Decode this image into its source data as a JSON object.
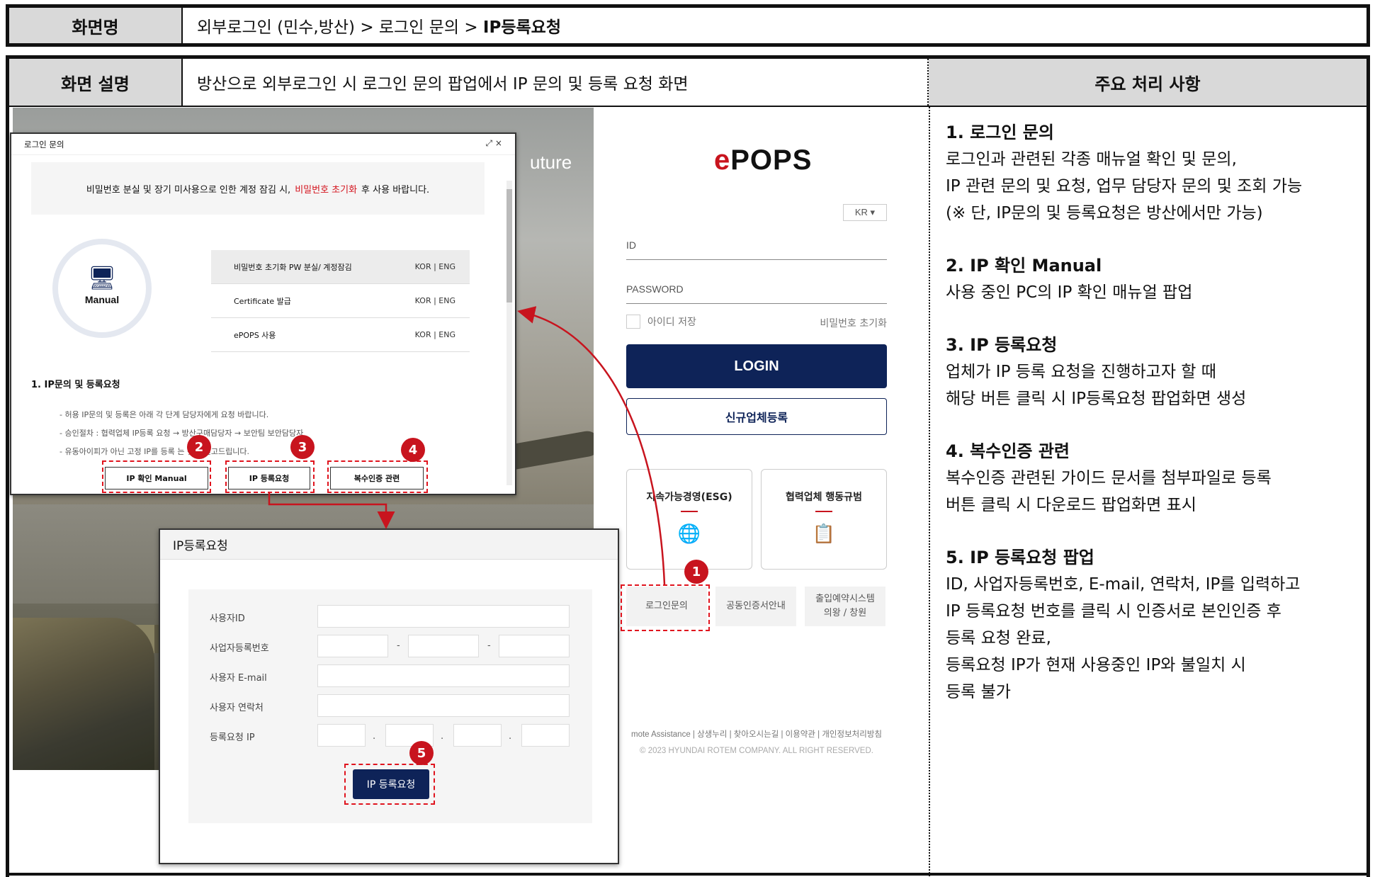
{
  "titlebar": {
    "label": "화면명",
    "path_prefix": "외부로그인 (민수,방산) > 로그인 문의 > ",
    "path_current": "IP등록요청"
  },
  "header": {
    "label": "화면 설명",
    "description": "방산으로 외부로그인 시 로그인 문의 팝업에서 IP 문의 및 등록 요청 화면",
    "side_title": "주요 처리 사항"
  },
  "notes": [
    {
      "title": "1.  로그인 문의",
      "lines": [
        "로그인과 관련된 각종 매뉴얼 확인 및 문의,",
        "IP 관련 문의 및 요청, 업무 담당자 문의 및 조회 가능",
        "(※ 단, IP문의 및 등록요청은 방산에서만 가능)"
      ]
    },
    {
      "title": "2.   IP 확인 Manual",
      "lines": [
        "사용 중인 PC의 IP 확인 매뉴얼 팝업"
      ]
    },
    {
      "title": "3.  IP 등록요청",
      "lines": [
        "업체가 IP 등록 요청을 진행하고자 할 때",
        "해당 버튼 클릭 시 IP등록요청 팝업화면 생성"
      ]
    },
    {
      "title": "4.  복수인증 관련",
      "lines": [
        "복수인증 관련된 가이드 문서를 첨부파일로 등록",
        "버튼 클릭 시 다운로드 팝업화면 표시"
      ]
    },
    {
      "title": "5.  IP 등록요청 팝업",
      "lines": [
        "ID, 사업자등록번호, E-mail, 연락처, IP를 입력하고",
        "IP 등록요청 번호를 클릭 시 인증서로 본인인증 후",
        "등록 요청 완료,",
        "등록요청 IP가 현재 사용중인 IP와 불일치 시",
        "등록 불가"
      ]
    }
  ],
  "background": {
    "slogan": "uture"
  },
  "login": {
    "logo_e": "e",
    "logo_rest": "POPS",
    "lang": "KR ▾",
    "id_label": "ID",
    "password_label": "PASSWORD",
    "save_id": "아이디 저장",
    "reset_pw": "비밀번호 초기화",
    "login_btn": "LOGIN",
    "register_btn": "신규업체등록",
    "card1": "지속가능경영(ESG)",
    "card2": "협력업체 행동규범",
    "q1": "로그인문의",
    "q2": "공동인증서안내",
    "q3_line1": "출입예약시스템",
    "q3_line2": "의왕 / 창원",
    "footer_links": "mote Assistance  |  상생누리  |  찾아오시는길  |  이용약관  |  개인정보처리방침",
    "copyright": "© 2023 HYUNDAI ROTEM COMPANY. ALL RIGHT RESERVED."
  },
  "inquiry_popup": {
    "title": "로그인 문의",
    "window_controls": "⤢  ×",
    "notice_pre": "비밀번호 분실 및 장기 미사용으로 인한 계정 잠김 시,",
    "notice_red": "비밀번호 초기화",
    "notice_post": "후 사용 바랍니다.",
    "manual_label": "Manual",
    "manuals": [
      {
        "name": "비밀번호 초기화 PW 분실/ 계정잠김",
        "langs": "KOR   |   ENG"
      },
      {
        "name": "Certificate 발급",
        "langs": "KOR   |   ENG"
      },
      {
        "name": "ePOPS 사용",
        "langs": "KOR   |   ENG"
      }
    ],
    "section_title": "1. IP문의 및 등록요청",
    "bullets": [
      "- 허용 IP문의 및 등록은 아래 각 단계 담당자에게 요청 바랍니다.",
      "- 승인절차 : 협력업체 IP등록 요청 → 방산구매담당자 → 보안팀 보안담당자",
      "- 유동아이피가 아닌 고정 IP를 등록         는 것을 권고드립니다."
    ],
    "btn_manual": "IP 확인 Manual",
    "btn_register": "IP 등록요청",
    "btn_multi": "복수인증 관련"
  },
  "ip_popup": {
    "title": "IP등록요청",
    "user_id": "사용자ID",
    "biz_no": "사업자등록번호",
    "email": "사용자 E-mail",
    "phone": "사용자 연락처",
    "ip": "등록요청 IP",
    "dash": "-",
    "dot": ".",
    "submit": "IP 등록요청"
  },
  "badges": [
    "1",
    "2",
    "3",
    "4",
    "5"
  ],
  "colors": {
    "accent_red": "#c8141e",
    "navy": "#0e2358",
    "header_gray": "#d9d9d9"
  }
}
